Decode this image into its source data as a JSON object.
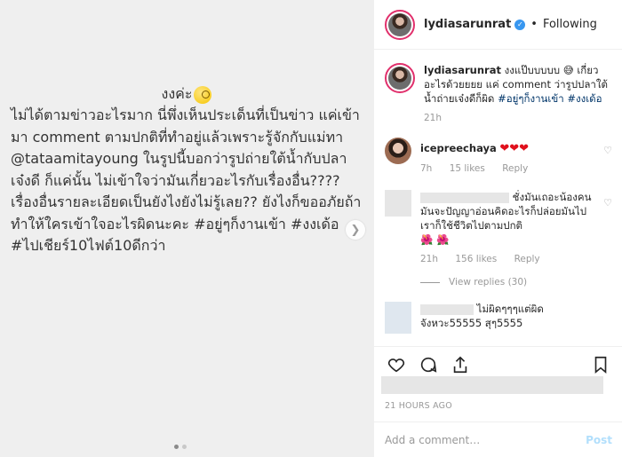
{
  "image_post": {
    "title": "งงค่ะ",
    "title_emoji": "face-with-monocle",
    "body": "ไม่ได้ตามข่าวอะไรมาก นี่พึ่งเห็นประเด็นที่เป็นข่าว แค่เข้ามา comment ตามปกติที่ทำอยู่แล้วเพราะรู้จักกับแม่ทา @tataamitayoung ในรูปนี้บอกว่ารูปถ่ายใต้น้ำกับปลาเจ๋งดี ก็แค่นั้น ไม่เข้าใจว่ามันเกี่ยวอะไรกับเรื่องอื่น???? เรื่องอื่นรายละเอียดเป็นยังไงยังไม่รู้เลย?? ยังไงก็ขออภัยถ้าทำให้ใครเข้าใจอะไรผิดนะคะ #อยู่ๆก็งานเข้า #งงเด้อ #ไปเชียร์10ไฟต์10ดีกว่า",
    "next_icon": "chevron-right-icon"
  },
  "header": {
    "username": "lydiasarunrat",
    "verified_icon": "verified-badge-icon",
    "separator": "•",
    "follow_status": "Following"
  },
  "caption": {
    "username": "lydiasarunrat",
    "text_part1": "งงแป๊บบบบบ",
    "emoji": "😅",
    "text_part2": "เกี่ยวอะไรด้วยยยย แค่ comment ว่ารูปปลาใต้น้ำถ่ายเจ๋งดีก็ผิด",
    "hashtag1": "#อยู่ๆก็งานเข้า",
    "hashtag2": "#งงเด้อ",
    "time": "21h"
  },
  "comments": [
    {
      "username": "icepreechaya",
      "text": "❤❤❤",
      "time": "7h",
      "likes": "15 likes",
      "reply": "Reply"
    },
    {
      "username": "",
      "text": "ชั่งมันเถอะน้องคนมันจะปัญญาอ่อนคิดอะไรก็ปล่อยมันไป เราก็ใช้ชีวิตไปตามปกติ",
      "flowers": "🌺 🌺",
      "time": "21h",
      "likes": "156 likes",
      "reply": "Reply",
      "view_replies": "View replies (30)"
    },
    {
      "username": "",
      "text": "ไม่ผิดๆๆๆแต่ผิดจังหวะ55555 สุๆ5555"
    }
  ],
  "actions": {
    "like_icon": "heart-icon",
    "comment_icon": "comment-icon",
    "share_icon": "share-icon",
    "save_icon": "bookmark-icon"
  },
  "timestamp": "21 HOURS AGO",
  "add_comment": {
    "placeholder": "Add a comment…",
    "post_label": "Post"
  }
}
